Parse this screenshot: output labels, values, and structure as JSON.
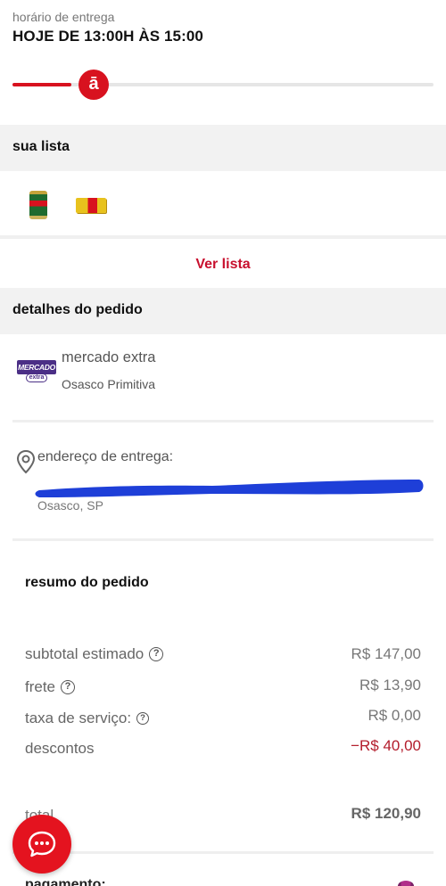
{
  "delivery": {
    "label": "horário de entrega",
    "time": "HOJE DE 13:00H ÀS 15:00",
    "progress_fraction": 0.14,
    "knob_glyph": "ā",
    "accent_color": "#d8121f"
  },
  "list": {
    "section_title": "sua lista",
    "products": [
      "beer-can-icon",
      "snack-pack-icon"
    ],
    "view_label": "Ver lista"
  },
  "order_details": {
    "section_title": "detalhes do pedido",
    "store": {
      "logo_text": "MERCADO",
      "logo_subtext": "extra",
      "name": "mercado extra",
      "city": "Osasco Primitiva"
    },
    "address": {
      "label": "endereço de entrega:",
      "city": "Osasco, SP",
      "street_redacted": true
    }
  },
  "summary": {
    "title": "resumo do pedido",
    "rows": [
      {
        "label": "subtotal estimado",
        "value": "R$ 147,00",
        "help": true
      },
      {
        "label": "frete",
        "value": "R$ 13,90",
        "help": true
      },
      {
        "label": "taxa de serviço:",
        "value": "R$ 0,00",
        "help": true
      },
      {
        "label": "descontos",
        "value": "−R$ 40,00",
        "help": false
      }
    ],
    "total_label": "total",
    "total_value": "R$ 120,90",
    "payment_label": "pagamento:",
    "discount_color": "#b31d2c"
  },
  "chat": {
    "icon": "chat-bubble-icon"
  }
}
